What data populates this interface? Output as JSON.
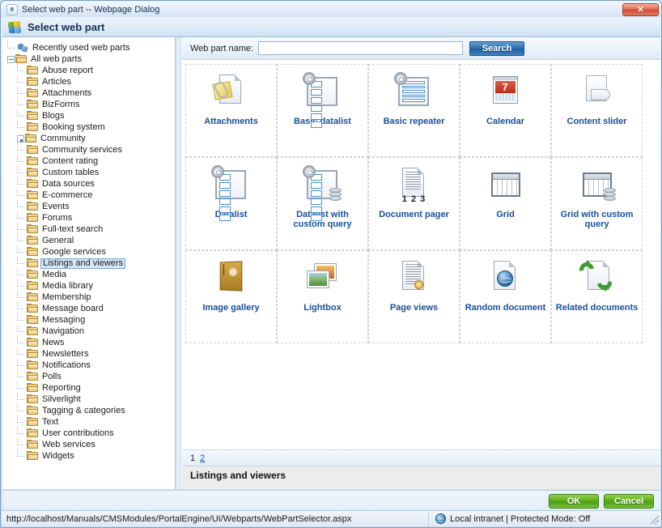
{
  "window": {
    "title": "Select web part -- Webpage Dialog",
    "title_icon": "ie-e-icon",
    "close_label": "✕"
  },
  "dialog": {
    "header_title": "Select web part",
    "header_icon": "puzzle-piece-icon"
  },
  "sidebar": {
    "items": [
      {
        "label": "Recently used web parts",
        "icon": "recently-used-icon",
        "indent": 1,
        "twist": "none",
        "selected": false
      },
      {
        "label": "All web parts",
        "icon": "folder-icon",
        "indent": 1,
        "twist": "minus",
        "selected": false
      },
      {
        "label": "Abuse report",
        "icon": "folder-icon",
        "indent": 2,
        "twist": "leaf",
        "selected": false
      },
      {
        "label": "Articles",
        "icon": "folder-icon",
        "indent": 2,
        "twist": "leaf",
        "selected": false
      },
      {
        "label": "Attachments",
        "icon": "folder-icon",
        "indent": 2,
        "twist": "leaf",
        "selected": false
      },
      {
        "label": "BizForms",
        "icon": "folder-icon",
        "indent": 2,
        "twist": "leaf",
        "selected": false
      },
      {
        "label": "Blogs",
        "icon": "folder-icon",
        "indent": 2,
        "twist": "leaf",
        "selected": false
      },
      {
        "label": "Booking system",
        "icon": "folder-icon",
        "indent": 2,
        "twist": "leaf",
        "selected": false
      },
      {
        "label": "Community",
        "icon": "folder-icon",
        "indent": 2,
        "twist": "plus",
        "selected": false
      },
      {
        "label": "Community services",
        "icon": "folder-icon",
        "indent": 2,
        "twist": "leaf",
        "selected": false
      },
      {
        "label": "Content rating",
        "icon": "folder-icon",
        "indent": 2,
        "twist": "leaf",
        "selected": false
      },
      {
        "label": "Custom tables",
        "icon": "folder-icon",
        "indent": 2,
        "twist": "leaf",
        "selected": false
      },
      {
        "label": "Data sources",
        "icon": "folder-icon",
        "indent": 2,
        "twist": "leaf",
        "selected": false
      },
      {
        "label": "E-commerce",
        "icon": "folder-icon",
        "indent": 2,
        "twist": "leaf",
        "selected": false
      },
      {
        "label": "Events",
        "icon": "folder-icon",
        "indent": 2,
        "twist": "leaf",
        "selected": false
      },
      {
        "label": "Forums",
        "icon": "folder-icon",
        "indent": 2,
        "twist": "leaf",
        "selected": false
      },
      {
        "label": "Full-text search",
        "icon": "folder-icon",
        "indent": 2,
        "twist": "leaf",
        "selected": false
      },
      {
        "label": "General",
        "icon": "folder-icon",
        "indent": 2,
        "twist": "leaf",
        "selected": false
      },
      {
        "label": "Google services",
        "icon": "folder-icon",
        "indent": 2,
        "twist": "leaf",
        "selected": false
      },
      {
        "label": "Listings and viewers",
        "icon": "folder-icon",
        "indent": 2,
        "twist": "leaf",
        "selected": true
      },
      {
        "label": "Media",
        "icon": "folder-icon",
        "indent": 2,
        "twist": "leaf",
        "selected": false
      },
      {
        "label": "Media library",
        "icon": "folder-icon",
        "indent": 2,
        "twist": "leaf",
        "selected": false
      },
      {
        "label": "Membership",
        "icon": "folder-icon",
        "indent": 2,
        "twist": "leaf",
        "selected": false
      },
      {
        "label": "Message board",
        "icon": "folder-icon",
        "indent": 2,
        "twist": "leaf",
        "selected": false
      },
      {
        "label": "Messaging",
        "icon": "folder-icon",
        "indent": 2,
        "twist": "leaf",
        "selected": false
      },
      {
        "label": "Navigation",
        "icon": "folder-icon",
        "indent": 2,
        "twist": "leaf",
        "selected": false
      },
      {
        "label": "News",
        "icon": "folder-icon",
        "indent": 2,
        "twist": "leaf",
        "selected": false
      },
      {
        "label": "Newsletters",
        "icon": "folder-icon",
        "indent": 2,
        "twist": "leaf",
        "selected": false
      },
      {
        "label": "Notifications",
        "icon": "folder-icon",
        "indent": 2,
        "twist": "leaf",
        "selected": false
      },
      {
        "label": "Polls",
        "icon": "folder-icon",
        "indent": 2,
        "twist": "leaf",
        "selected": false
      },
      {
        "label": "Reporting",
        "icon": "folder-icon",
        "indent": 2,
        "twist": "leaf",
        "selected": false
      },
      {
        "label": "Silverlight",
        "icon": "folder-icon",
        "indent": 2,
        "twist": "leaf",
        "selected": false
      },
      {
        "label": "Tagging & categories",
        "icon": "folder-icon",
        "indent": 2,
        "twist": "leaf",
        "selected": false
      },
      {
        "label": "Text",
        "icon": "folder-icon",
        "indent": 2,
        "twist": "leaf",
        "selected": false
      },
      {
        "label": "User contributions",
        "icon": "folder-icon",
        "indent": 2,
        "twist": "leaf",
        "selected": false
      },
      {
        "label": "Web services",
        "icon": "folder-icon",
        "indent": 2,
        "twist": "leaf",
        "selected": false
      },
      {
        "label": "Widgets",
        "icon": "folder-icon",
        "indent": 2,
        "twist": "leaf",
        "selected": false
      }
    ]
  },
  "search": {
    "label": "Web part name:",
    "value": "",
    "placeholder": "",
    "button_label": "Search"
  },
  "grid": {
    "rows": [
      [
        {
          "label": "Attachments",
          "icon": "attachments-icon"
        },
        {
          "label": "Basic datalist",
          "icon": "basic-datalist-icon"
        },
        {
          "label": "Basic repeater",
          "icon": "basic-repeater-icon"
        },
        {
          "label": "Calendar",
          "icon": "calendar-icon"
        },
        {
          "label": "Content slider",
          "icon": "content-slider-icon"
        }
      ],
      [
        {
          "label": "Datalist",
          "icon": "datalist-icon"
        },
        {
          "label": "Datalist with custom query",
          "icon": "datalist-custom-query-icon"
        },
        {
          "label": "Document pager",
          "icon": "document-pager-icon"
        },
        {
          "label": "Grid",
          "icon": "grid-icon"
        },
        {
          "label": "Grid with custom query",
          "icon": "grid-custom-query-icon"
        }
      ],
      [
        {
          "label": "Image gallery",
          "icon": "image-gallery-icon"
        },
        {
          "label": "Lightbox",
          "icon": "lightbox-icon"
        },
        {
          "label": "Page views",
          "icon": "page-views-icon"
        },
        {
          "label": "Random document",
          "icon": "random-document-icon"
        },
        {
          "label": "Related documents",
          "icon": "related-documents-icon"
        }
      ]
    ],
    "calendar_day": "7",
    "pager_numbers": "1 2 3"
  },
  "pagination": {
    "current": "1",
    "next": "2"
  },
  "category": {
    "title": "Listings and viewers"
  },
  "footer": {
    "ok_label": "OK",
    "cancel_label": "Cancel"
  },
  "statusbar": {
    "url": "http://localhost/Manuals/CMSModules/PortalEngine/UI/Webparts/WebPartSelector.aspx",
    "zone": "Local intranet | Protected Mode: Off",
    "zone_icon": "globe-icon"
  },
  "colors": {
    "link": "#17509c",
    "accent": "#2f6fae",
    "ok_green": "#5cae1f",
    "close_red": "#d24a33"
  }
}
